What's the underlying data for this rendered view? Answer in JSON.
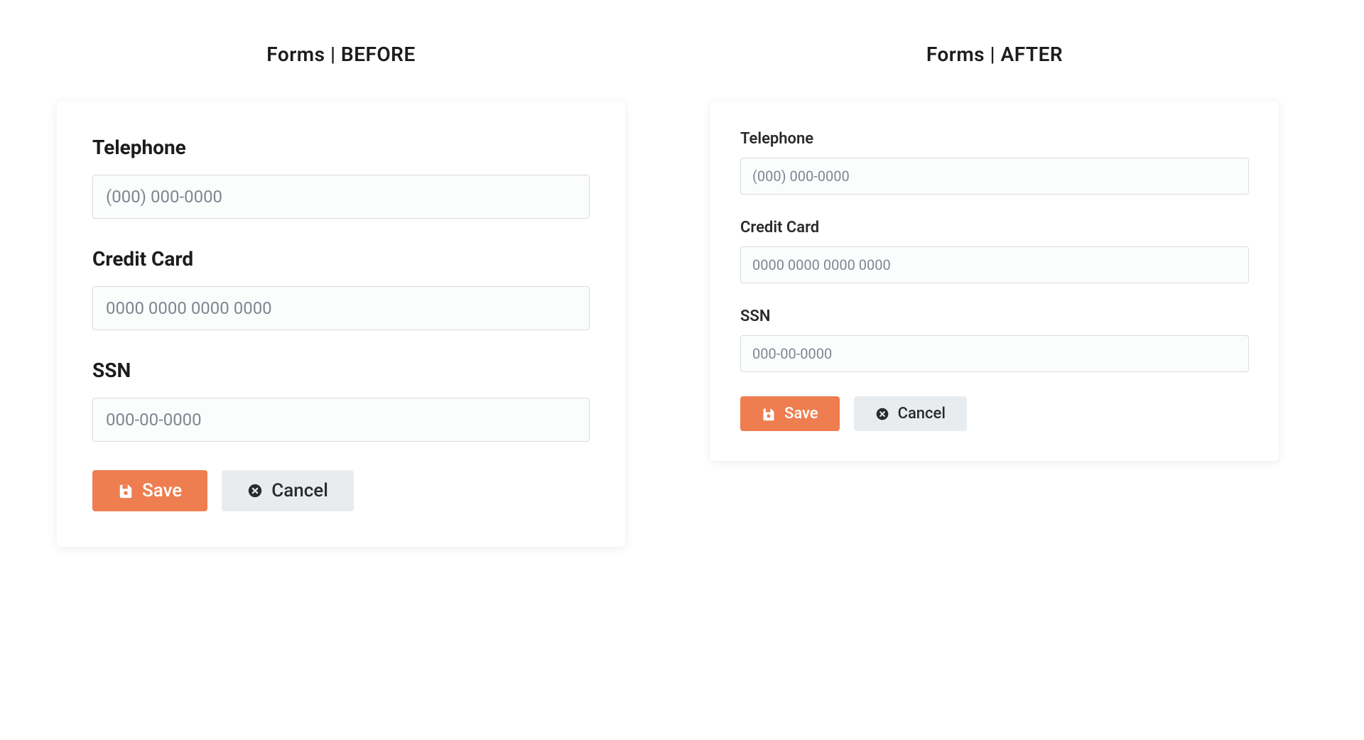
{
  "before": {
    "title": "Forms  |  BEFORE",
    "fields": {
      "telephone": {
        "label": "Telephone",
        "placeholder": "(000) 000-0000"
      },
      "credit_card": {
        "label": "Credit Card",
        "placeholder": "0000 0000 0000 0000"
      },
      "ssn": {
        "label": "SSN",
        "placeholder": "000-00-0000"
      }
    },
    "buttons": {
      "save": "Save",
      "cancel": "Cancel"
    }
  },
  "after": {
    "title": "Forms  |  AFTER",
    "fields": {
      "telephone": {
        "label": "Telephone",
        "placeholder": "(000) 000-0000"
      },
      "credit_card": {
        "label": "Credit Card",
        "placeholder": "0000 0000 0000 0000"
      },
      "ssn": {
        "label": "SSN",
        "placeholder": "000-00-0000"
      }
    },
    "buttons": {
      "save": "Save",
      "cancel": "Cancel"
    }
  },
  "colors": {
    "primary": "#ee7e50",
    "secondary_bg": "#e8ecee"
  }
}
